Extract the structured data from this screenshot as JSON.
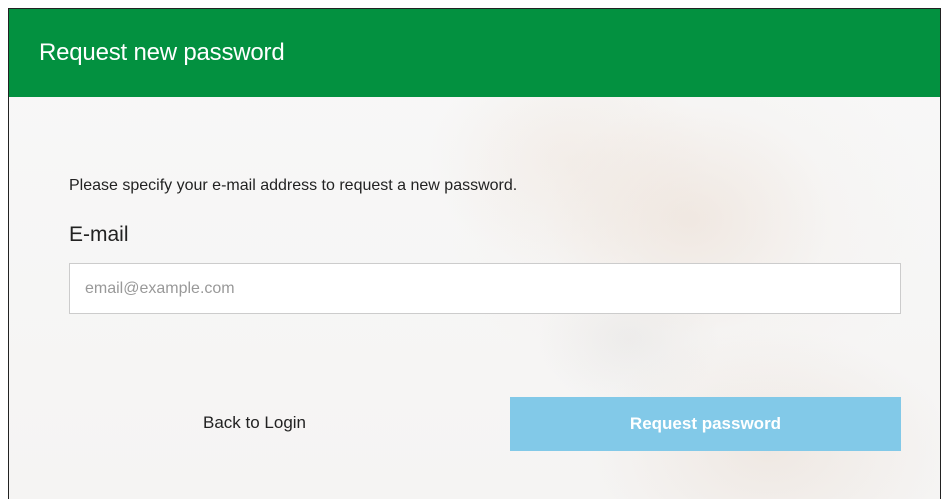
{
  "header": {
    "title": "Request new password"
  },
  "form": {
    "instructions": "Please specify your e-mail address to request a new password.",
    "email_label": "E-mail",
    "email_value": "",
    "email_placeholder": "email@example.com",
    "back_link_label": "Back to Login",
    "submit_label": "Request password"
  },
  "colors": {
    "header_bg": "#039140",
    "button_bg": "#82c9e8"
  }
}
